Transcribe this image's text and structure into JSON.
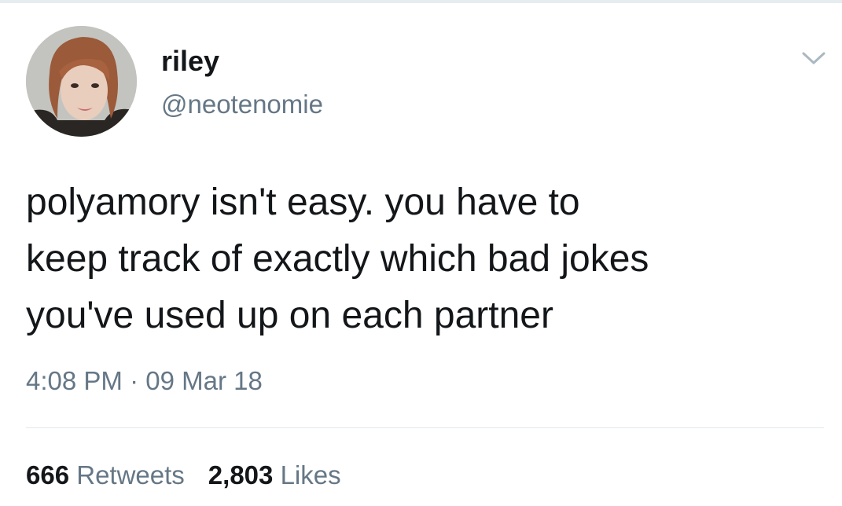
{
  "tweet": {
    "author": {
      "display_name": "riley",
      "handle": "@neotenomie",
      "avatar_icon": "user-avatar-photo"
    },
    "menu_icon": "chevron-down-icon",
    "text": "polyamory isn't easy. you have to\nkeep track of exactly which bad jokes\nyou've used up on each partner",
    "time": "4:08 PM",
    "separator": "·",
    "date": "09 Mar 18",
    "stats": {
      "retweets_count": "666",
      "retweets_label": "Retweets",
      "likes_count": "2,803",
      "likes_label": "Likes"
    }
  },
  "colors": {
    "text_primary": "#14171a",
    "text_secondary": "#657786",
    "divider": "#e1e8ed",
    "background": "#ffffff"
  }
}
